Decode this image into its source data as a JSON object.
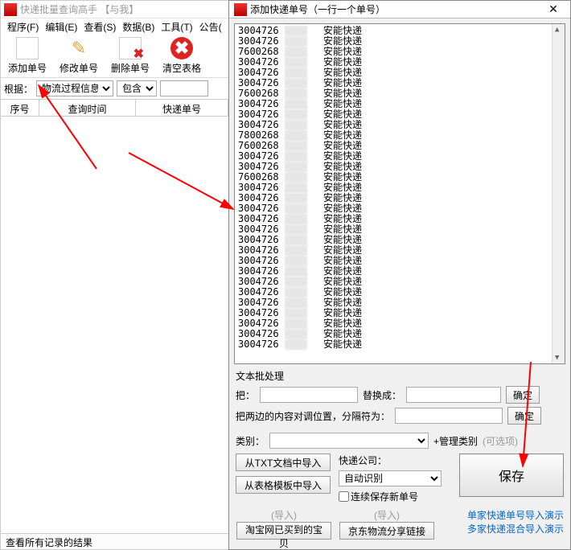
{
  "main": {
    "title": "快递批量查询高手 【与我】",
    "menu": [
      "程序(F)",
      "编辑(E)",
      "查看(S)",
      "数据(B)",
      "工具(T)",
      "公告("
    ],
    "toolbar": [
      {
        "label": "添加单号",
        "icon": "📄"
      },
      {
        "label": "修改单号",
        "icon": "✏️"
      },
      {
        "label": "删除单号",
        "icon": "✖"
      },
      {
        "label": "清空表格",
        "icon": "✖"
      }
    ],
    "filter": {
      "label": "根据：",
      "combo1": "物流过程信息",
      "combo2": "包含",
      "input": ""
    },
    "columns": [
      "序号",
      "查询时间",
      "快递单号"
    ],
    "status": "查看所有记录的结果"
  },
  "dialog": {
    "title": "添加快递单号（一行一个单号）",
    "rows": [
      {
        "a": "3004726",
        "b": "96",
        "c": "安能快递"
      },
      {
        "a": "3004726",
        "b": "99",
        "c": "安能快递"
      },
      {
        "a": "7600268",
        "b": "41",
        "c": "安能快递"
      },
      {
        "a": "3004726",
        "b": "80",
        "c": "安能快递"
      },
      {
        "a": "3004726",
        "b": "73",
        "c": "安能快递"
      },
      {
        "a": "3004726",
        "b": "75",
        "c": "安能快递"
      },
      {
        "a": "7600268",
        "b": "8",
        "c": "安能快递"
      },
      {
        "a": "3004726",
        "b": "9",
        "c": "安能快递"
      },
      {
        "a": "3004726",
        "b": "0",
        "c": "安能快递"
      },
      {
        "a": "3004726",
        "b": "9",
        "c": "安能快递"
      },
      {
        "a": "7800268",
        "b": "5",
        "c": "安能快递"
      },
      {
        "a": "7600268",
        "b": "5",
        "c": "安能快递"
      },
      {
        "a": "3004726",
        "b": "8",
        "c": "安能快递"
      },
      {
        "a": "3004726",
        "b": "7",
        "c": "安能快递"
      },
      {
        "a": "7600268",
        "b": "7",
        "c": "安能快递"
      },
      {
        "a": "3004726",
        "b": "4",
        "c": "安能快递"
      },
      {
        "a": "3004726",
        "b": "6",
        "c": "安能快递"
      },
      {
        "a": "3004726",
        "b": "3",
        "c": "安能快递"
      },
      {
        "a": "3004726",
        "b": "4",
        "c": "安能快递"
      },
      {
        "a": "3004726",
        "b": "6",
        "c": "安能快递"
      },
      {
        "a": "3004726",
        "b": "3",
        "c": "安能快递"
      },
      {
        "a": "3004726",
        "b": "7",
        "c": "安能快递"
      },
      {
        "a": "3004726",
        "b": "5",
        "c": "安能快递"
      },
      {
        "a": "3004726",
        "b": "4",
        "c": "安能快递"
      },
      {
        "a": "3004726",
        "b": "2",
        "c": "安能快递"
      },
      {
        "a": "3004726",
        "b": "1",
        "c": "安能快递"
      },
      {
        "a": "3004726",
        "b": "7",
        "c": "安能快递"
      },
      {
        "a": "3004726",
        "b": "9",
        "c": "安能快递"
      },
      {
        "a": "3004726",
        "b": "5",
        "c": "安能快递"
      },
      {
        "a": "3004726",
        "b": "9",
        "c": "安能快递"
      },
      {
        "a": "3004726",
        "b": "8",
        "c": "安能快递"
      }
    ],
    "batch": {
      "title": "文本批处理",
      "replace_a": "把：",
      "replace_b": "替换成：",
      "ok": "确定",
      "swap": "把两边的内容对调位置，分隔符为：",
      "catLabel": "类别：",
      "catLink": "+管理类别",
      "optional": "(可选项)",
      "importTxt": "从TXT文档中导入",
      "importTpl": "从表格模板中导入",
      "companyLabel": "快递公司：",
      "companySel": "自动识别",
      "keepSave": "连续保存新单号",
      "save": "保存",
      "importHint": "(导入)",
      "taobao": "淘宝网已买到的宝贝",
      "jd": "京东物流分享链接",
      "demo1": "单家快递单号导入演示",
      "demo2": "多家快递混合导入演示"
    }
  }
}
